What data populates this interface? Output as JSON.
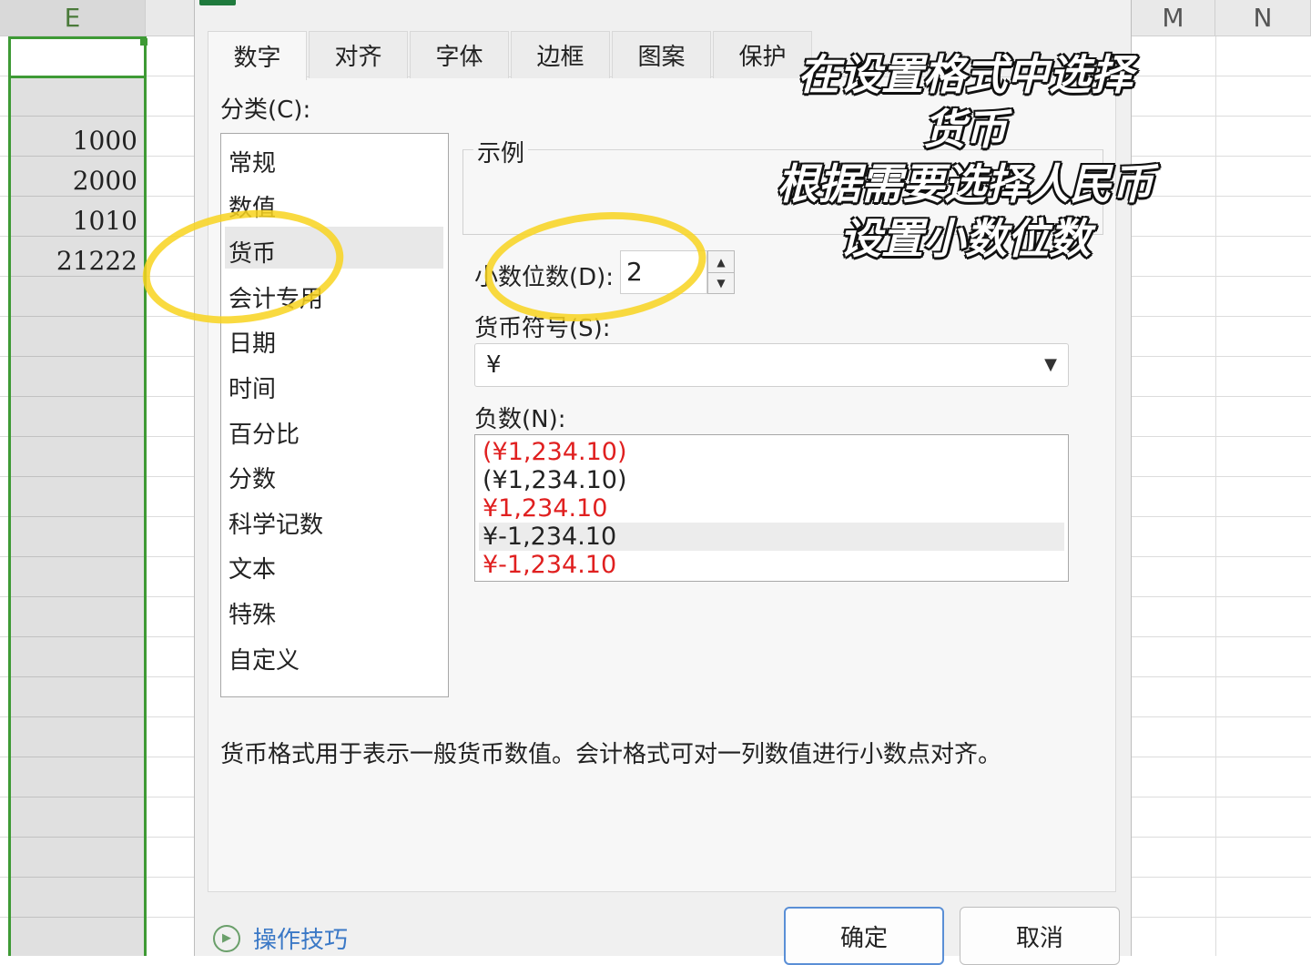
{
  "spreadsheet": {
    "columns": [
      "E",
      "M",
      "N"
    ],
    "cells": [
      "1000",
      "2000",
      "1010",
      "21222"
    ]
  },
  "dialog": {
    "tabs": [
      {
        "label": "数字",
        "active": true
      },
      {
        "label": "对齐",
        "active": false
      },
      {
        "label": "字体",
        "active": false
      },
      {
        "label": "边框",
        "active": false
      },
      {
        "label": "图案",
        "active": false
      },
      {
        "label": "保护",
        "active": false
      }
    ],
    "category_label": "分类(C):",
    "categories": [
      "常规",
      "数值",
      "货币",
      "会计专用",
      "日期",
      "时间",
      "百分比",
      "分数",
      "科学记数",
      "文本",
      "特殊",
      "自定义"
    ],
    "selected_category": "货币",
    "sample_label": "示例",
    "decimal_label": "小数位数(D):",
    "decimal_value": "2",
    "symbol_label": "货币符号(S):",
    "symbol_value": "¥",
    "negative_label": "负数(N):",
    "negative_options": [
      {
        "text": "(¥1,234.10)",
        "color": "#e02020"
      },
      {
        "text": "(¥1,234.10)",
        "color": "#222222"
      },
      {
        "text": "¥1,234.10",
        "color": "#e02020"
      },
      {
        "text": "¥-1,234.10",
        "color": "#222222"
      },
      {
        "text": "¥-1,234.10",
        "color": "#e02020"
      }
    ],
    "selected_negative_index": 3,
    "description": "货币格式用于表示一般货币数值。会计格式可对一列数值进行小数点对齐。",
    "help_label": "操作技巧",
    "ok_label": "确定",
    "cancel_label": "取消"
  },
  "annotation": {
    "lines": [
      "在设置格式中选择",
      "货币",
      "根据需要选择人民币",
      "设置小数位数"
    ],
    "highlight_color": "#f8d41e"
  }
}
